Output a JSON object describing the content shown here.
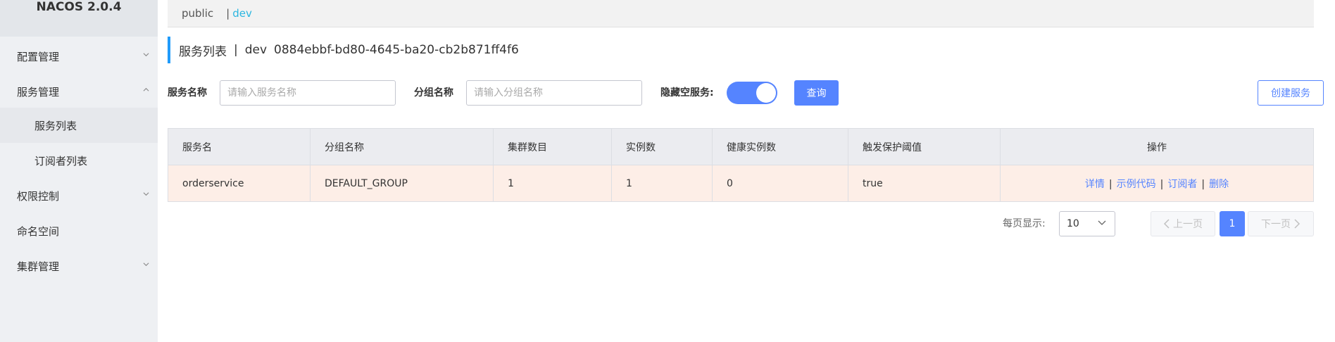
{
  "brand": "NACOS 2.0.4",
  "sidebar": {
    "items": [
      {
        "label": "配置管理"
      },
      {
        "label": "服务管理"
      },
      {
        "label": "服务列表"
      },
      {
        "label": "订阅者列表"
      },
      {
        "label": "权限控制"
      },
      {
        "label": "命名空间"
      },
      {
        "label": "集群管理"
      }
    ]
  },
  "namespace": {
    "public": "public",
    "separator": "|",
    "dev": "dev"
  },
  "title": {
    "main": "服务列表",
    "separator": "|",
    "namespace": "dev",
    "namespace_id": "0884ebbf-bd80-4645-ba20-cb2b871ff4f6"
  },
  "filters": {
    "service_name_label": "服务名称",
    "service_name_placeholder": "请输入服务名称",
    "group_name_label": "分组名称",
    "group_name_placeholder": "请输入分组名称",
    "hide_empty_label": "隐藏空服务:",
    "hide_empty_on": true,
    "query_label": "查询",
    "create_label": "创建服务"
  },
  "table": {
    "headers": [
      "服务名",
      "分组名称",
      "集群数目",
      "实例数",
      "健康实例数",
      "触发保护阈值",
      "操作"
    ],
    "rows": [
      {
        "service": "orderservice",
        "group": "DEFAULT_GROUP",
        "clusters": "1",
        "instances": "1",
        "healthy": "0",
        "threshold": "true",
        "ops": [
          "详情",
          "示例代码",
          "订阅者",
          "删除"
        ]
      }
    ]
  },
  "pagination": {
    "per_page_label": "每页显示:",
    "per_page_value": "10",
    "prev_label": "上一页",
    "current_page": "1",
    "next_label": "下一页"
  },
  "colors": {
    "primary": "#5584ff",
    "row_highlight": "#fdeee7",
    "sidebar_bg": "#eef0f3",
    "ns_active": "#2bb6e0"
  }
}
